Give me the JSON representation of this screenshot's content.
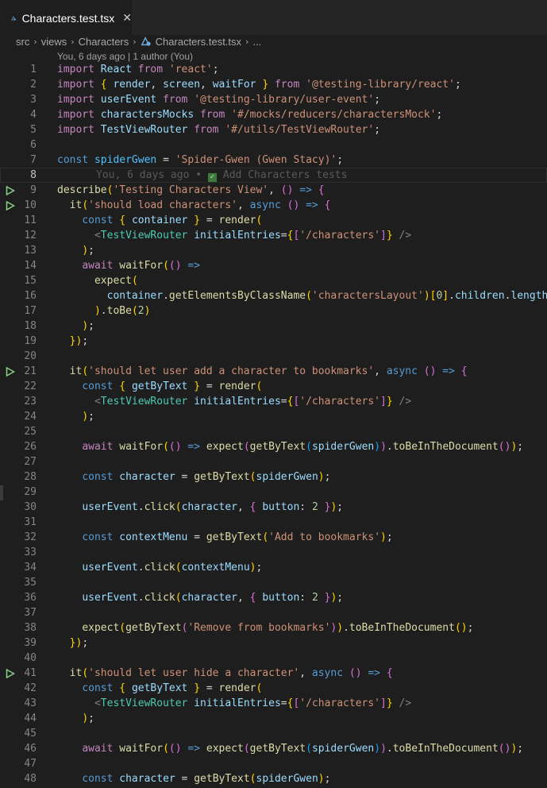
{
  "tab": {
    "filename": "Characters.test.tsx",
    "close": "✕",
    "icon": "react-test-file-icon"
  },
  "breadcrumb": [
    "src",
    "views",
    "Characters",
    "Characters.test.tsx",
    "..."
  ],
  "blame_header": "You, 6 days ago | 1 author (You)",
  "inline_blame": {
    "text": "You, 6 days ago • ",
    "message": "Add Characters tests"
  },
  "run_lines": [
    9,
    10,
    21,
    41
  ],
  "lines": [
    "import React from 'react';",
    "import { render, screen, waitFor } from '@testing-library/react';",
    "import userEvent from '@testing-library/user-event';",
    "import charactersMocks from '#/mocks/reducers/charactersMock';",
    "import TestViewRouter from '#/utils/TestViewRouter';",
    "",
    "const spiderGwen = 'Spider-Gwen (Gwen Stacy)';",
    "",
    "describe('Testing Characters View', () => {",
    "  it('should load characters', async () => {",
    "    const { container } = render(",
    "      <TestViewRouter initialEntries={['/characters']} />",
    "    );",
    "    await waitFor(() =>",
    "      expect(",
    "        container.getElementsByClassName('charactersLayout')[0].children.length",
    "      ).toBe(2)",
    "    );",
    "  });",
    "",
    "  it('should let user add a character to bookmarks', async () => {",
    "    const { getByText } = render(",
    "      <TestViewRouter initialEntries={['/characters']} />",
    "    );",
    "",
    "    await waitFor(() => expect(getByText(spiderGwen)).toBeInTheDocument());",
    "",
    "    const character = getByText(spiderGwen);",
    "",
    "    userEvent.click(character, { button: 2 });",
    "",
    "    const contextMenu = getByText('Add to bookmarks');",
    "",
    "    userEvent.click(contextMenu);",
    "",
    "    userEvent.click(character, { button: 2 });",
    "",
    "    expect(getByText('Remove from bookmarks')).toBeInTheDocument();",
    "  });",
    "",
    "  it('should let user hide a character', async () => {",
    "    const { getByText } = render(",
    "      <TestViewRouter initialEntries={['/characters']} />",
    "    );",
    "",
    "    await waitFor(() => expect(getByText(spiderGwen)).toBeInTheDocument());",
    "",
    "    const character = getByText(spiderGwen);"
  ],
  "colors": {
    "keyword_control": "#c586c0",
    "keyword": "#569cd6",
    "string": "#ce9178",
    "function": "#dcdcaa",
    "variable": "#9cdcfe",
    "constant": "#4fc1ff",
    "type": "#4ec9b0",
    "number": "#b5cea8",
    "run_icon": "#89d185",
    "editor_bg": "#1e1e1e"
  }
}
